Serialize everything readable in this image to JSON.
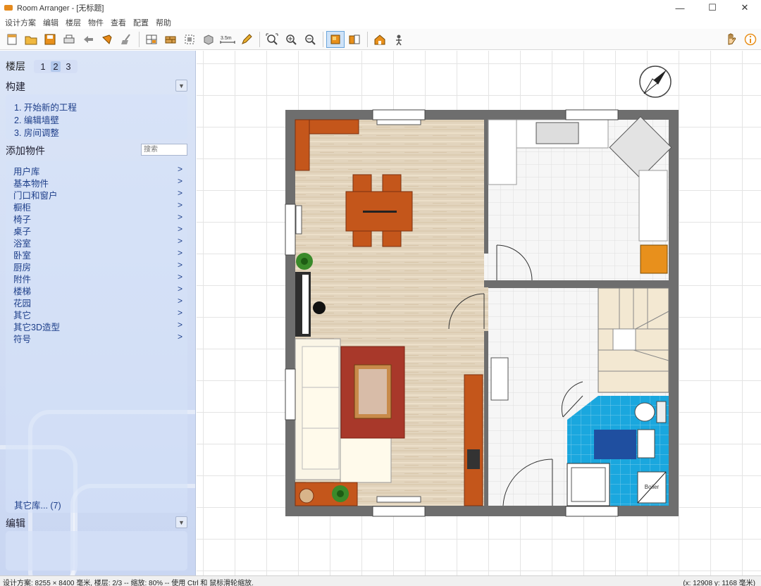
{
  "window": {
    "title": "Room Arranger - [无标题]",
    "controls": [
      "—",
      "☐",
      "✕"
    ]
  },
  "menus": [
    "设计方案",
    "编辑",
    "楼层",
    "物件",
    "查看",
    "配置",
    "帮助"
  ],
  "toolbar": {
    "groups": [
      [
        "new-file-icon",
        "open-folder-icon",
        "save-icon",
        "print-icon",
        "undo-icon",
        "eyedropper-icon",
        "broom-icon"
      ],
      [
        "grid-tool-icon",
        "wall-tool-icon",
        "select-region-icon",
        "box-3d-icon",
        "measure-icon",
        "pencil-icon"
      ],
      [
        "zoom-fit-icon",
        "zoom-in-icon",
        "zoom-out-icon"
      ],
      [
        "view-2d-icon",
        "view-3d-icon"
      ],
      [
        "house-3d-icon",
        "walkthrough-icon"
      ]
    ],
    "measure_label": "3.5m",
    "right": [
      "hand-icon",
      "info-icon"
    ]
  },
  "sidebar": {
    "floors_label": "楼层",
    "floors": [
      "1",
      "2",
      "3"
    ],
    "active_floor": "2",
    "build": {
      "title": "构建",
      "steps": [
        "1. 开始新的工程",
        "2. 编辑墙壁",
        "3. 房间调整"
      ]
    },
    "add_objects": {
      "title": "添加物件",
      "search_placeholder": "搜索",
      "categories": [
        "用户库",
        "基本物件",
        "门口和窗户",
        "橱柜",
        "椅子",
        "桌子",
        "浴室",
        "卧室",
        "厨房",
        "附件",
        "楼梯",
        "花园",
        "其它",
        "其它3D造型",
        "符号"
      ],
      "arrow": ">",
      "more_libraries": "其它库... (7)"
    },
    "edit": {
      "title": "编辑"
    }
  },
  "floorplan": {
    "wall_color": "#6e6e6e",
    "floor_wood_color": "#e2d4bd",
    "tile_color": "#f4f4f4",
    "bath_tile_color": "#1aa7de",
    "furniture_orange": "#c4561b",
    "rug_color": "#a8382a",
    "boiler_label": "Boiler"
  },
  "statusbar": {
    "left": "设计方案: 8255 × 8400 毫米, 楼层: 2/3 -- 缩放: 80% -- 使用 Ctrl 和 鼠标滑轮缩放.",
    "right": "(x: 12908 y: 1168 毫米)"
  },
  "colors": {
    "panel_bg": "#d3def5",
    "link_blue": "#1e3f8a",
    "active_toolbar": "#cfe3f8"
  }
}
